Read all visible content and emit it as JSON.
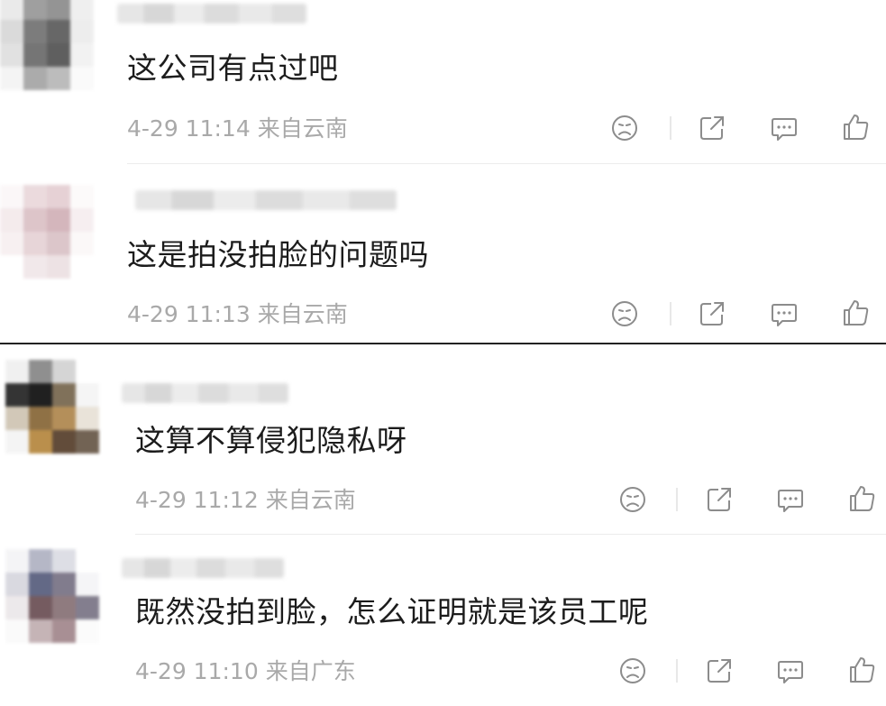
{
  "comments": [
    {
      "text": "这公司有点过吧",
      "time": "4-29 11:14",
      "location": "来自云南"
    },
    {
      "text": "这是拍没拍脸的问题吗",
      "time": "4-29 11:13",
      "location": "来自云南"
    },
    {
      "text": "这算不算侵犯隐私呀",
      "time": "4-29 11:12",
      "location": "来自云南"
    },
    {
      "text": "既然没拍到脸，怎么证明就是该员工呢",
      "time": "4-29 11:10",
      "location": "来自广东"
    }
  ],
  "icons": [
    "dislike-icon",
    "share-icon",
    "reply-icon",
    "like-icon"
  ],
  "colors": {
    "text": "#1c1c1c",
    "meta": "#a9a9a9",
    "icon": "#8c8c8c",
    "divider": "#ececec"
  }
}
